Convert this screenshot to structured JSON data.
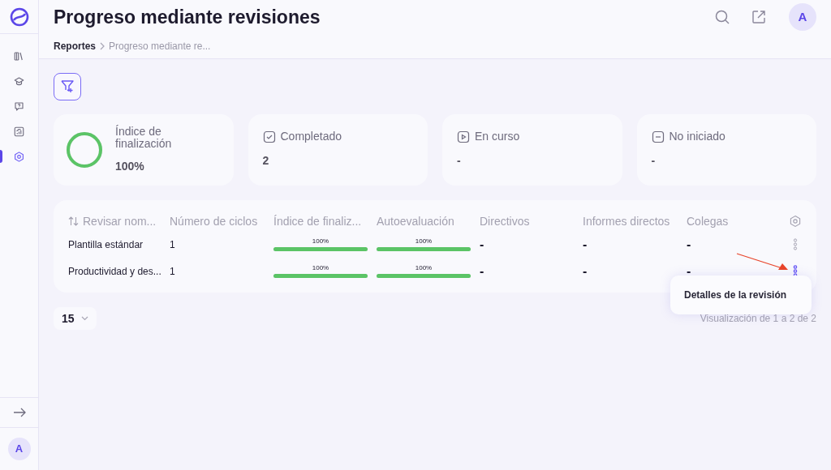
{
  "page_title": "Progreso mediante revisiones",
  "header_avatar": "A",
  "breadcrumb": [
    "Reportes",
    "Progreso mediante re..."
  ],
  "sidebar": {
    "items": [
      {
        "selected": false
      },
      {
        "selected": false
      },
      {
        "selected": false
      },
      {
        "selected": false
      },
      {
        "selected": true
      }
    ],
    "avatar": "A"
  },
  "stats": [
    {
      "kind": "ring",
      "label": "Índice de finalización",
      "value": "100%",
      "level": 1
    },
    {
      "kind": "check",
      "label": "Completado",
      "value": "2"
    },
    {
      "kind": "play",
      "label": "En curso",
      "value": "-"
    },
    {
      "kind": "minus",
      "label": "No iniciado",
      "value": "-"
    }
  ],
  "table": {
    "columns": [
      "Revisar nom...",
      "Número de ciclos",
      "Índice de finaliz...",
      "Autoevaluación",
      "Directivos",
      "Informes directos",
      "Colegas"
    ],
    "rows": [
      {
        "name": "Plantilla estándar",
        "cycles": "1",
        "completion": {
          "label": "100%",
          "level": 1
        },
        "self": {
          "label": "100%",
          "level": 1
        },
        "managers": "-",
        "reports": "-",
        "peers": "-",
        "menu_open": false
      },
      {
        "name": "Productividad y des...",
        "cycles": "1",
        "completion": {
          "label": "100%",
          "level": 1
        },
        "self": {
          "label": "100%",
          "level": 1
        },
        "managers": "-",
        "reports": "-",
        "peers": "-",
        "menu_open": true
      }
    ]
  },
  "row_menu": {
    "items": [
      "Detalles de la revisión"
    ]
  },
  "page_size": "15",
  "pagination_info": "Visualización de 1 a 2 de 2"
}
